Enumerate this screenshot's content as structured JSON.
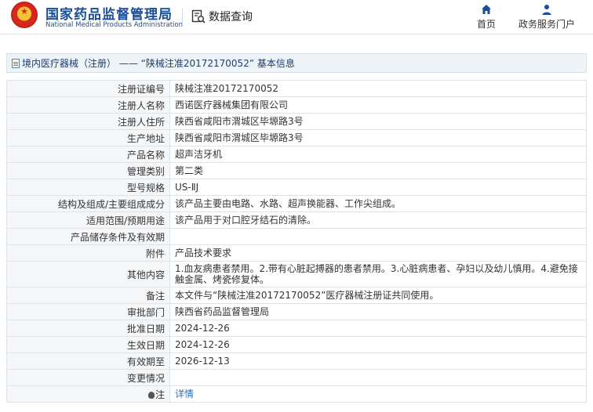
{
  "header": {
    "org_cn": "国家药品监督管理局",
    "org_en": "National Medical Products Administration",
    "query_label": "数据查询",
    "nav": [
      {
        "label": "首页",
        "icon": "home-icon"
      },
      {
        "label": "政务服务门户",
        "icon": "user-icon"
      }
    ]
  },
  "title_bar": {
    "text": "境内医疗器械（注册） —— “陕械注准20172170052” 基本信息"
  },
  "rows": [
    {
      "label": "注册证编号",
      "value": "陕械注准20172170052"
    },
    {
      "label": "注册人名称",
      "value": "西诺医疗器械集团有限公司"
    },
    {
      "label": "注册人住所",
      "value": "陕西省咸阳市渭城区毕塬路3号"
    },
    {
      "label": "生产地址",
      "value": "陕西省咸阳市渭城区毕塬路3号"
    },
    {
      "label": "产品名称",
      "value": "超声洁牙机"
    },
    {
      "label": "管理类别",
      "value": "第二类"
    },
    {
      "label": "型号规格",
      "value": "US-ⅡJ"
    },
    {
      "label": "结构及组成/主要组成成分",
      "value": "该产品主要由电路、水路、超声换能器、工作尖组成。"
    },
    {
      "label": "适用范围/预期用途",
      "value": "该产品用于对口腔牙结石的清除。"
    },
    {
      "label": "产品储存条件及有效期",
      "value": ""
    },
    {
      "label": "附件",
      "value": "产品技术要求"
    },
    {
      "label": "其他内容",
      "value": "1.血友病患者禁用。2.带有心脏起搏器的患者禁用。3.心脏病患者、孕妇以及幼儿慎用。4.避免接触金属、烤瓷修复体。"
    },
    {
      "label": "备注",
      "value": "本文件与“陕械注准20172170052”医疗器械注册证共同使用。"
    },
    {
      "label": "审批部门",
      "value": "陕西省药品监督管理局"
    },
    {
      "label": "批准日期",
      "value": "2024-12-26"
    },
    {
      "label": "生效日期",
      "value": "2024-12-26"
    },
    {
      "label": "有效期至",
      "value": "2026-12-13"
    },
    {
      "label": "变更情况",
      "value": ""
    },
    {
      "label": "注",
      "value": "详情"
    }
  ]
}
